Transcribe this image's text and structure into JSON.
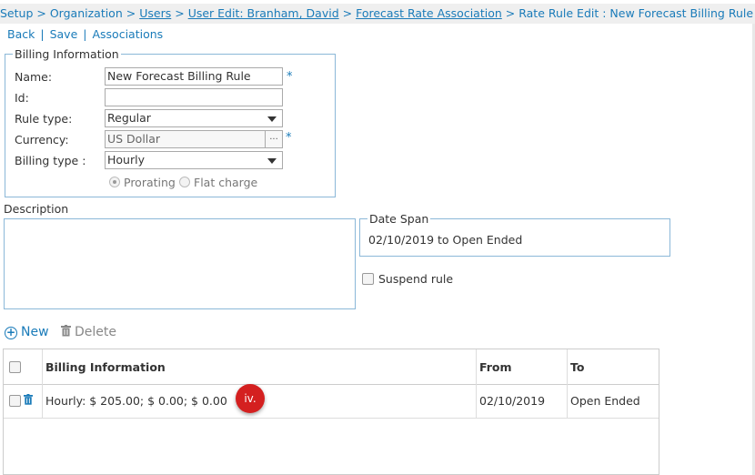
{
  "breadcrumb": {
    "setup": "Setup",
    "sep": ">",
    "organization": "Organization",
    "users": "Users",
    "user_edit": "User Edit: Branham, David",
    "forecast_rate": "Forecast Rate Association",
    "current": "Rate Rule Edit : New Forecast Billing Rule"
  },
  "actions": {
    "back": "Back",
    "save": "Save",
    "associations": "Associations",
    "divider": "|"
  },
  "billing": {
    "legend": "Billing Information",
    "name_label": "Name:",
    "name_value": "New Forecast Billing Rule",
    "id_label": "Id:",
    "id_value": "",
    "rule_type_label": "Rule type:",
    "rule_type_value": "Regular",
    "currency_label": "Currency:",
    "currency_value": "US Dollar",
    "currency_button": "...",
    "billing_type_label": "Billing type :",
    "billing_type_value": "Hourly",
    "required_mark": "*",
    "radio_prorating": "Prorating",
    "radio_flat": "Flat charge",
    "selected_radio": "Prorating"
  },
  "description": {
    "label": "Description",
    "value": ""
  },
  "date_span": {
    "legend": "Date Span",
    "value": "02/10/2019 to Open Ended"
  },
  "suspend": {
    "label": "Suspend rule",
    "checked": false
  },
  "toolbar": {
    "new_label": "New",
    "delete_label": "Delete"
  },
  "grid": {
    "columns": [
      "Billing Information",
      "From",
      "To"
    ],
    "rows": [
      {
        "billing_info": "Hourly: $ 205.00; $ 0.00; $ 0.00",
        "from": "02/10/2019",
        "to": "Open Ended"
      }
    ]
  },
  "annotation": {
    "text": "iv."
  },
  "colors": {
    "link": "#1a7bb9",
    "border": "#8bb8d8",
    "badge": "#d42020"
  }
}
